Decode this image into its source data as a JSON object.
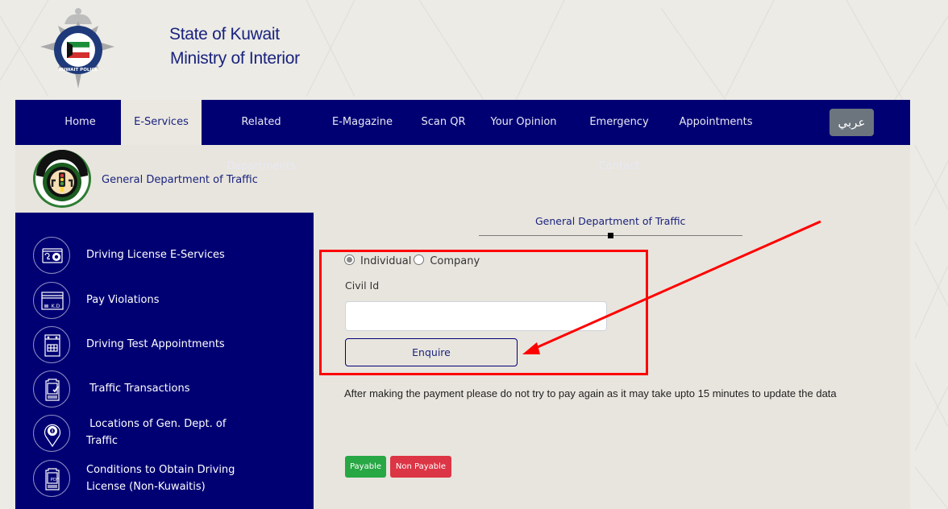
{
  "header": {
    "logo_icon": "kuwait-police-emblem",
    "brand_line1": "State of Kuwait",
    "brand_line2": "Ministry of Interior"
  },
  "nav": {
    "items": [
      {
        "label": "Home",
        "active": false
      },
      {
        "label": "E-Services",
        "active": true
      },
      {
        "label": "Related Departments",
        "active": false
      },
      {
        "label": "E-Magazine",
        "active": false
      },
      {
        "label": "Scan QR",
        "active": false
      },
      {
        "label": "Your Opinion",
        "active": false
      },
      {
        "label": "Emergency Contact",
        "active": false
      },
      {
        "label": "Appointments",
        "active": false
      }
    ],
    "language_button": "عربي"
  },
  "department": {
    "logo_icon": "traffic-department-emblem",
    "title": "General Department of Traffic"
  },
  "sidebar": {
    "items": [
      {
        "icon": "driving-license-icon",
        "label": "Driving License E-Services"
      },
      {
        "icon": "pay-violations-icon",
        "label": "Pay Violations"
      },
      {
        "icon": "calendar-icon",
        "label": "Driving Test Appointments"
      },
      {
        "icon": "clipboard-check-icon",
        "label": " Traffic Transactions"
      },
      {
        "icon": "location-pin-icon",
        "label": " Locations of Gen. Dept. of Traffic"
      },
      {
        "icon": "pdf-document-icon",
        "label": "Conditions to Obtain Driving License (Non-Kuwaitis)"
      }
    ]
  },
  "main": {
    "section_title": "General Department of Traffic",
    "form": {
      "radio_options": [
        {
          "label": "Individual",
          "checked": true
        },
        {
          "label": "Company",
          "checked": false
        }
      ],
      "civil_id_label": "Civil Id",
      "civil_id_value": "",
      "civil_id_placeholder": "",
      "enquire_label": "Enquire"
    },
    "notice": "After making the payment please do not try to pay again as it may take upto 15 minutes to update the data",
    "legend": {
      "payable_label": "Payable",
      "non_payable_label": "Non Payable"
    }
  },
  "colors": {
    "navy": "#000073",
    "title_blue": "#1a237e",
    "annotation_red": "#ff0000",
    "payable_green": "#28a745",
    "non_payable_red": "#dc3545",
    "lang_gray": "#6c757d"
  }
}
